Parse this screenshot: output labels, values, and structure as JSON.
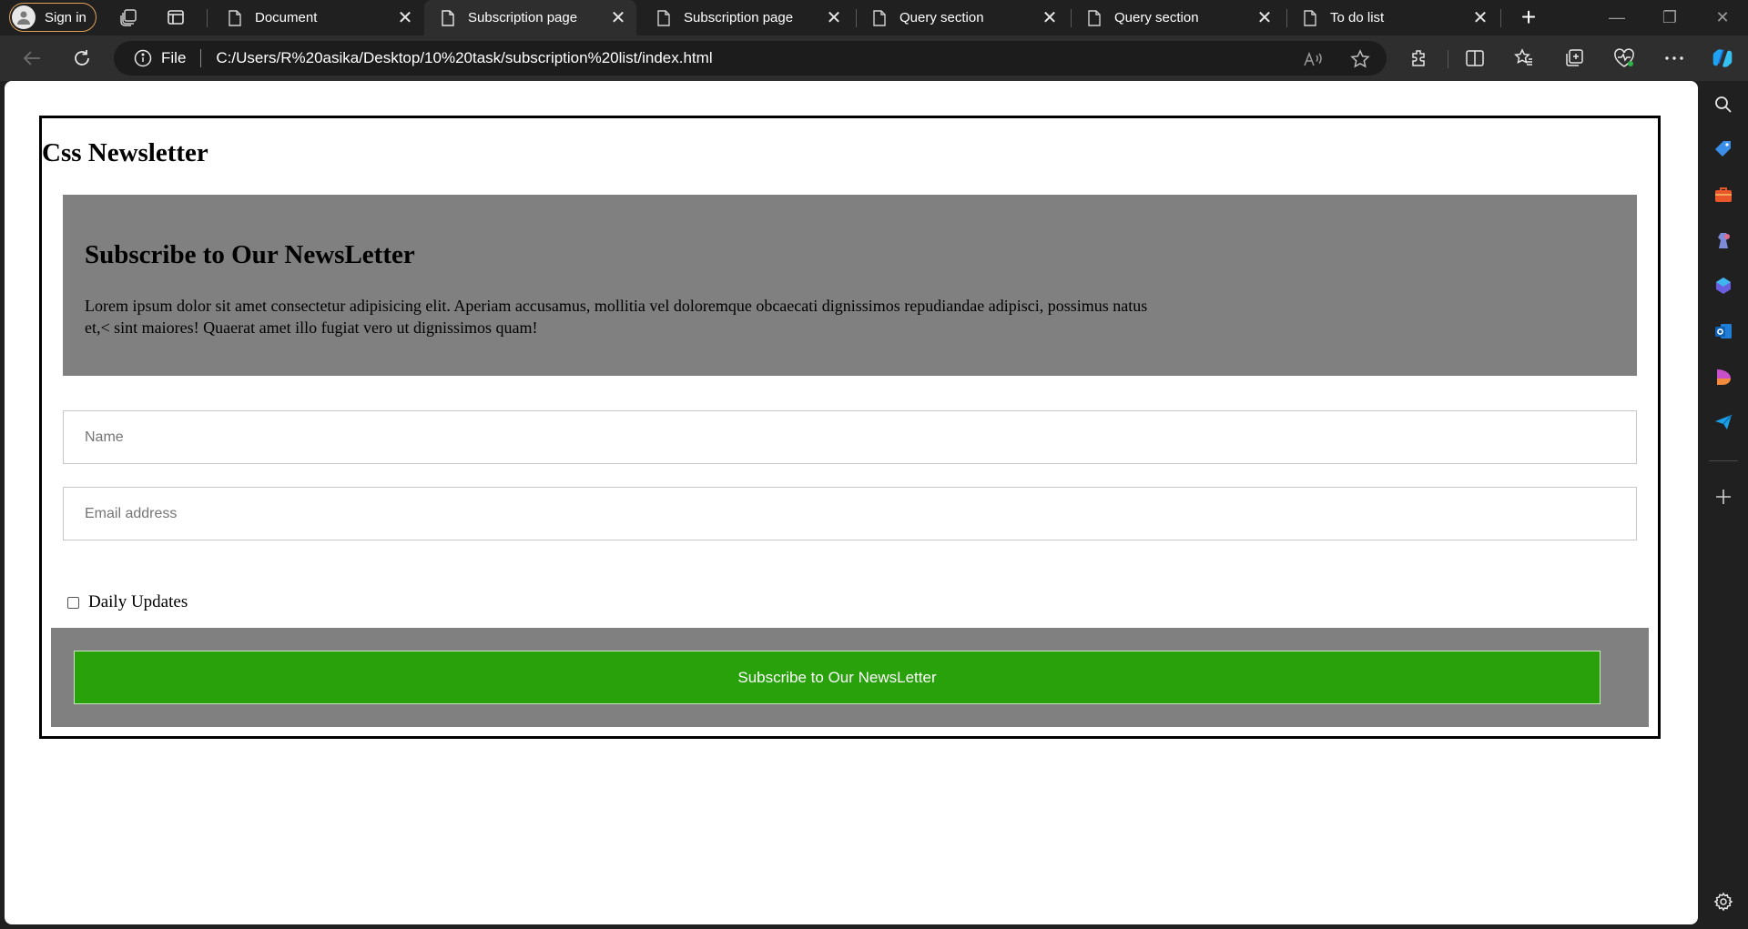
{
  "browser": {
    "signin_label": "Sign in",
    "tabs": [
      {
        "title": "Document",
        "active": false
      },
      {
        "title": "Subscription page",
        "active": true
      },
      {
        "title": "Subscription page",
        "active": false
      },
      {
        "title": "Query section",
        "active": false
      },
      {
        "title": "Query section",
        "active": false
      },
      {
        "title": "To do list",
        "active": false
      }
    ],
    "address": {
      "scheme_label": "File",
      "url": "C:/Users/R%20asika/Desktop/10%20task/subscription%20list/index.html"
    },
    "colors": {
      "chrome": "#202020",
      "toolbar": "#2e2e2e",
      "signin_border": "#e0a15a"
    }
  },
  "page": {
    "title": "Css Newsletter",
    "banner": {
      "heading": "Subscribe to Our NewsLetter",
      "text": "Lorem ipsum dolor sit amet consectetur adipisicing elit. Aperiam accusamus, mollitia vel doloremque obcaecati dignissimos repudiandae adipisci, possimus natus et,< sint maiores! Quaerat amet illo fugiat vero ut dignissimos quam!"
    },
    "form": {
      "name_placeholder": "Name",
      "email_placeholder": "Email address",
      "checkbox_label": "Daily Updates",
      "checkbox_checked": false,
      "submit_label": "Subscribe to Our NewsLetter"
    },
    "colors": {
      "banner_bg": "#808080",
      "button_bg": "#28a10a",
      "frame_border": "#000000"
    }
  }
}
